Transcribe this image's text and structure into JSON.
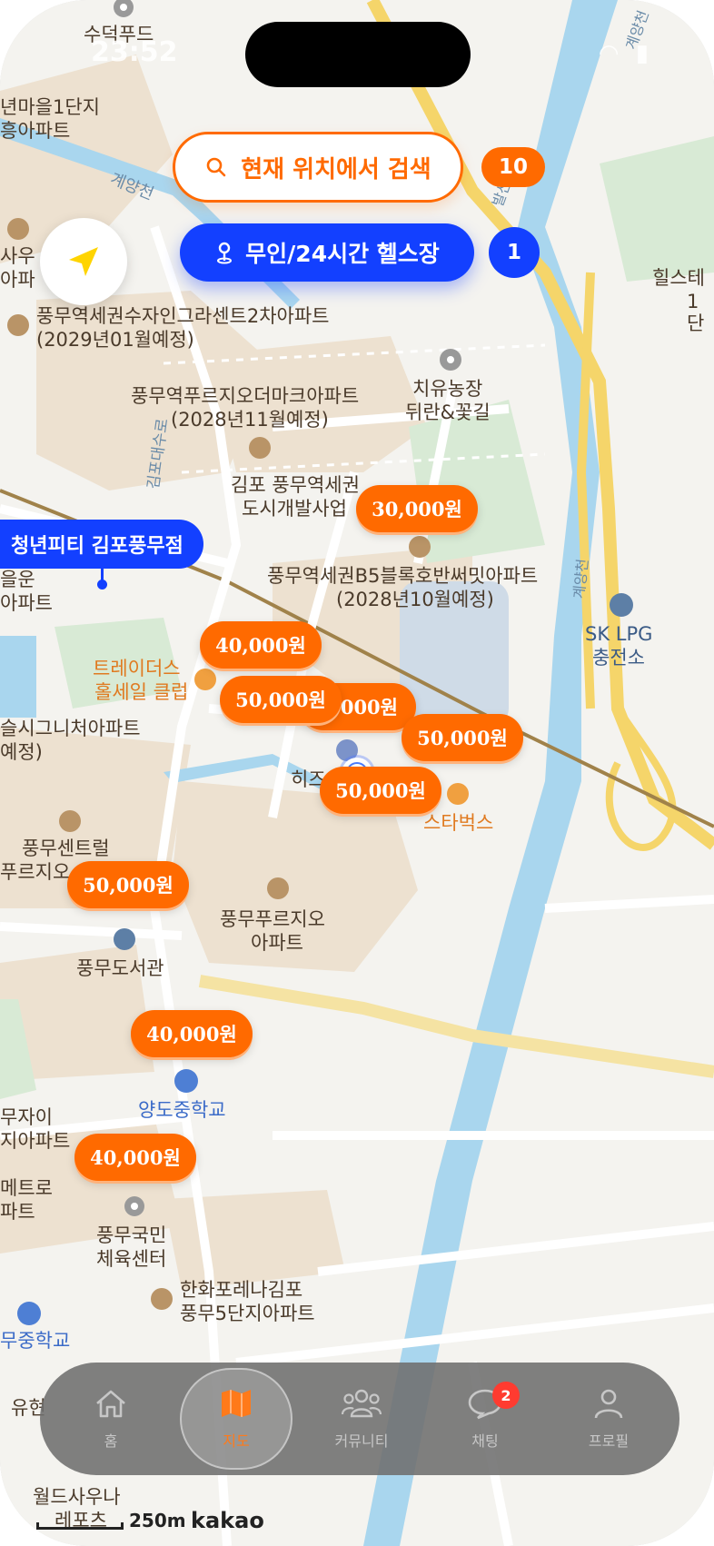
{
  "status": {
    "time": "23:52"
  },
  "top_controls": {
    "search_label": "현재 위치에서 검색",
    "search_count": "10",
    "filter_label": "무인/24시간 헬스장",
    "filter_count": "1"
  },
  "gym_label": "청년피티 김포풍무점",
  "prices": [
    {
      "label": "30,000원"
    },
    {
      "label": "40,000원"
    },
    {
      "label": "0,000원"
    },
    {
      "label": "50,000원"
    },
    {
      "label": "50,000원"
    },
    {
      "label": "50,000원"
    },
    {
      "label": "50,000원"
    },
    {
      "label": "40,000원"
    },
    {
      "label": "40,000원"
    }
  ],
  "map_labels": {
    "l1": "수덕푸드",
    "l2": "년마을1단지",
    "l3": "흥아파트",
    "l4": "계양천",
    "l5": "사우",
    "l6": "아파",
    "l7": "풍무역세권수자인그라센트2차아파트",
    "l8": "(2029년01월예정)",
    "l9": "풍무역푸르지오더마크아파트",
    "l10": "(2028년11월예정)",
    "l11": "치유농장",
    "l12": "뒤란&꽃길",
    "l13": "김포대수로",
    "l14": "김포 풍무역세권",
    "l15": "도시개발사업",
    "l16": "풍무역세권B5블록호반써밋아파트",
    "l17": "(2028년10월예정)",
    "l18": "계양천",
    "l19": "SK LPG",
    "l20": "충전소",
    "l21": "힐스테",
    "l22": "1단",
    "l23": "트레이더스",
    "l24": "홀세일 클럽",
    "l25": "슬시그니처아파트",
    "l26": "예정)",
    "l27": "히즈",
    "l28": "스타벅스",
    "l29": "풍무센트럴",
    "l30": "푸르지오",
    "l31": "풍무푸르지오",
    "l32": "아파트",
    "l33": "풍무도서관",
    "l34": "양도중학교",
    "l35": "무자이",
    "l36": "지아파트",
    "l37": "메트로",
    "l38": "파트",
    "l39": "풍무국민",
    "l40": "체육센터",
    "l41": "한화포레나김포",
    "l42": "풍무5단지아파트",
    "l43": "무중학교",
    "l44": "월드사우나",
    "l45": "레포츠",
    "l46": "유현",
    "l47": "발산",
    "l48": "계양천",
    "l49": "을운",
    "l50": "아파트"
  },
  "tabs": [
    {
      "label": "홈",
      "icon": "home-icon"
    },
    {
      "label": "지도",
      "icon": "map-icon",
      "active": true
    },
    {
      "label": "커뮤니티",
      "icon": "community-icon"
    },
    {
      "label": "채팅",
      "icon": "chat-icon",
      "badge": "2"
    },
    {
      "label": "프로필",
      "icon": "profile-icon"
    }
  ],
  "map_footer": {
    "scale": "250m",
    "provider": "kakao"
  },
  "colors": {
    "accent": "#ff6a00",
    "blue": "#1340ff"
  }
}
